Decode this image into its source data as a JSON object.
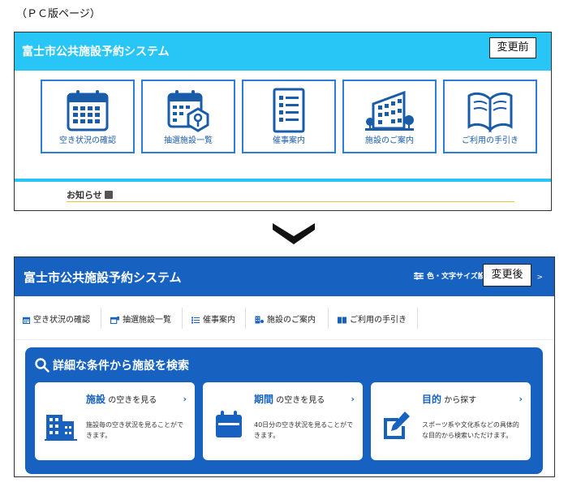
{
  "page_label": "（ＰＣ版ページ）",
  "before": {
    "title": "富士市公共施設予約システム",
    "tag": "変更前",
    "tiles": [
      {
        "label": "空き状況の確認",
        "icon": "calendar-icon"
      },
      {
        "label": "抽選施設一覧",
        "icon": "lottery-calendar-icon"
      },
      {
        "label": "催事案内",
        "icon": "document-list-icon"
      },
      {
        "label": "施設のご案内",
        "icon": "building-icon"
      },
      {
        "label": "ご利用の手引き",
        "icon": "book-icon"
      }
    ],
    "news_label": "お知らせ",
    "news_icon": "rss-icon"
  },
  "after": {
    "title": "富士市公共施設予約システム",
    "settings_label": "色・文字サイズ設定",
    "settings_icon": "sliders-icon",
    "tag": "変更後",
    "nav": [
      {
        "label": "空き状況の確認",
        "icon": "calendar-icon"
      },
      {
        "label": "抽選施設一覧",
        "icon": "lottery-icon"
      },
      {
        "label": "催事案内",
        "icon": "list-icon"
      },
      {
        "label": "施設のご案内",
        "icon": "building-icon"
      },
      {
        "label": "ご利用の手引き",
        "icon": "book-icon"
      }
    ],
    "search": {
      "title": "詳細な条件から施設を検索",
      "cards": [
        {
          "strong": "施設",
          "rest": " の空きを見る",
          "desc": "施設毎の空き状況を見ることができます。",
          "icon": "building-icon"
        },
        {
          "strong": "期間",
          "rest": " の空きを見る",
          "desc": "40日分の空き状況を見ることができます。",
          "icon": "calendar-icon"
        },
        {
          "strong": "目的",
          "rest": " から探す",
          "desc": "スポーツ系や文化系などの具体的な目的から検索いただけます。",
          "icon": "edit-icon"
        }
      ],
      "arrow": "›"
    }
  },
  "colors": {
    "before_header": "#27c6f7",
    "tile_border": "#2b7fd8",
    "after_header": "#1762c0",
    "news_underline": "#e8c33a"
  }
}
